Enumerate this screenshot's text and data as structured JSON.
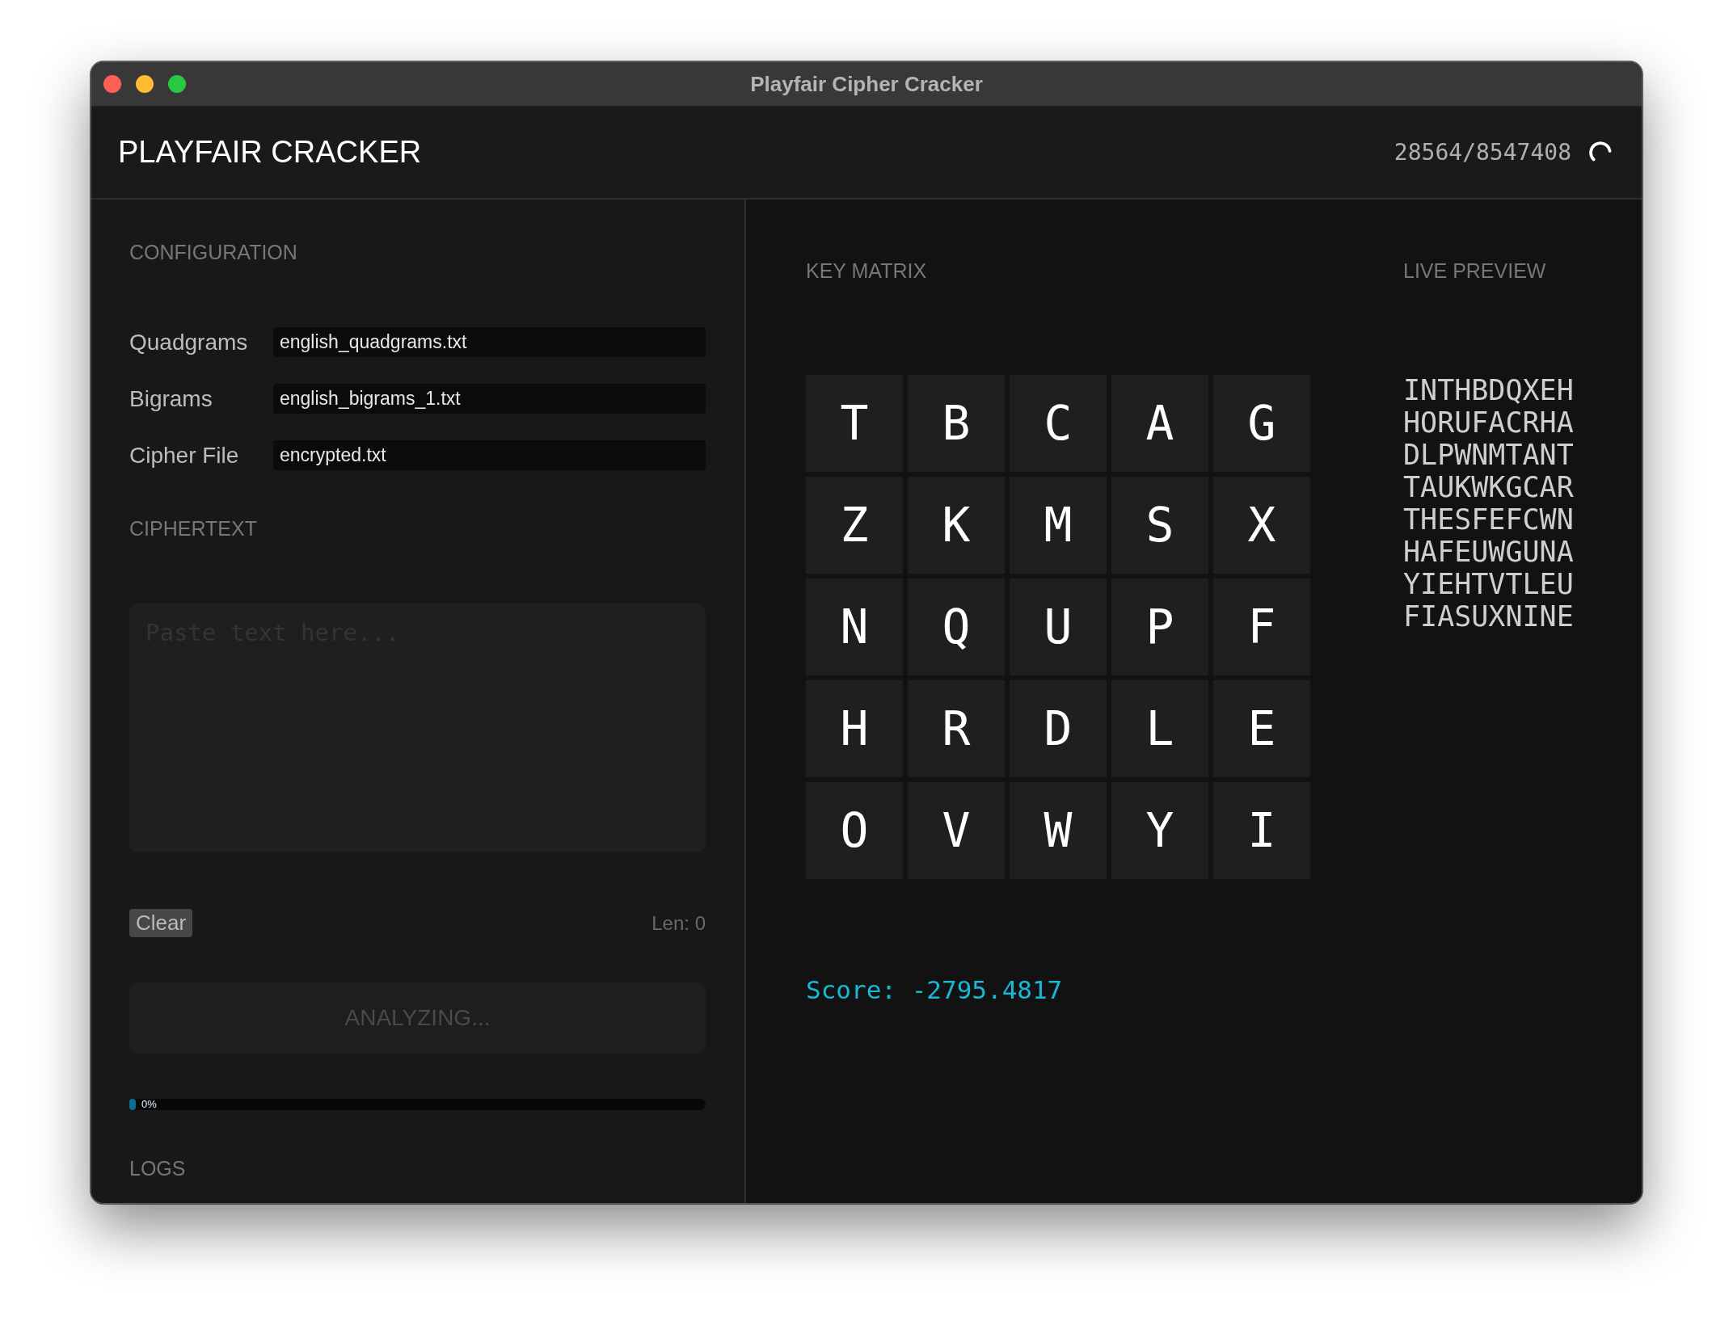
{
  "window": {
    "title": "Playfair Cipher Cracker"
  },
  "header": {
    "title": "PLAYFAIR CRACKER",
    "counter": "28564/8547408",
    "busy": true
  },
  "configuration": {
    "title": "CONFIGURATION",
    "fields": [
      {
        "label": "Quadgrams",
        "value": "english_quadgrams.txt"
      },
      {
        "label": "Bigrams",
        "value": "english_bigrams_1.txt"
      },
      {
        "label": "Cipher File",
        "value": "encrypted.txt"
      }
    ]
  },
  "ciphertext": {
    "title": "CIPHERTEXT",
    "placeholder": "Paste text here...",
    "clear_button": "Clear",
    "length": "Len: 0"
  },
  "analyze_button": {
    "label": "ANALYZING...",
    "disabled": true
  },
  "progress": {
    "level": 0,
    "label": "0%"
  },
  "logs": {
    "title": "LOGS"
  },
  "key_matrix": {
    "title": "KEY MATRIX",
    "rows": [
      [
        "T",
        "B",
        "C",
        "A",
        "G"
      ],
      [
        "Z",
        "K",
        "M",
        "S",
        "X"
      ],
      [
        "N",
        "Q",
        "U",
        "P",
        "F"
      ],
      [
        "H",
        "R",
        "D",
        "L",
        "E"
      ],
      [
        "O",
        "V",
        "W",
        "Y",
        "I"
      ]
    ],
    "score": "Score: -2795.4817"
  },
  "live_preview": {
    "title": "LIVE PREVIEW",
    "lines": [
      "INTHBDQXEH",
      "HORUFACRHA",
      "DLPWNMTANT",
      "TAUKWKGCAR",
      "THESFEFCWN",
      "HAFEUWGUNA",
      "YIEHTVTLEU",
      "FIASUXNINE"
    ]
  }
}
